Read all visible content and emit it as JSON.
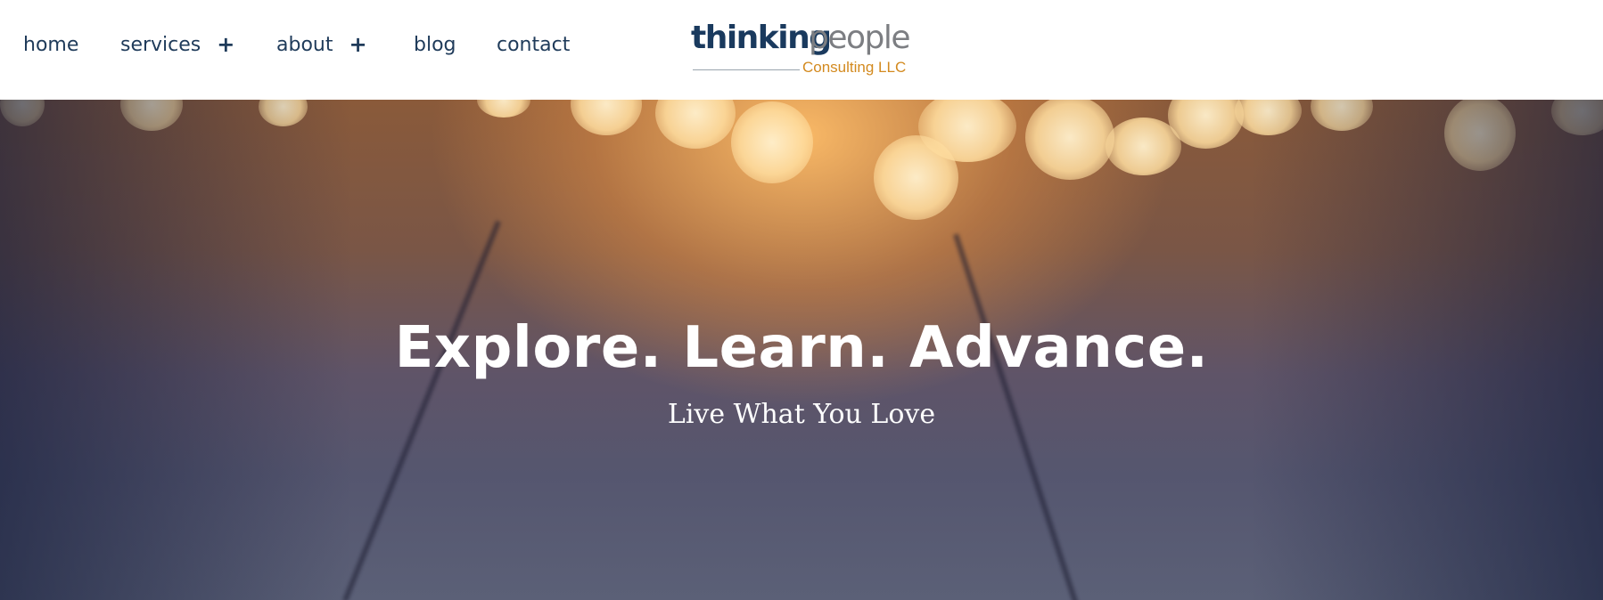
{
  "nav": {
    "items": [
      {
        "label": "home",
        "has_submenu": false
      },
      {
        "label": "services",
        "has_submenu": true
      },
      {
        "label": "about",
        "has_submenu": true
      },
      {
        "label": "blog",
        "has_submenu": false
      },
      {
        "label": "contact",
        "has_submenu": false
      }
    ],
    "submenu_glyph": "+"
  },
  "logo": {
    "word_primary": "thinking",
    "word_secondary": "people",
    "tagline": "Consulting LLC"
  },
  "hero": {
    "title": "Explore. Learn. Advance.",
    "subtitle": "Live What You Love"
  },
  "colors": {
    "nav_text": "#1f3b5a",
    "logo_primary": "#1a3a5e",
    "logo_secondary": "#7c7e82",
    "logo_tagline": "#d38a1f",
    "hero_text": "#ffffff"
  },
  "icons": {
    "submenu": "plus-icon"
  }
}
